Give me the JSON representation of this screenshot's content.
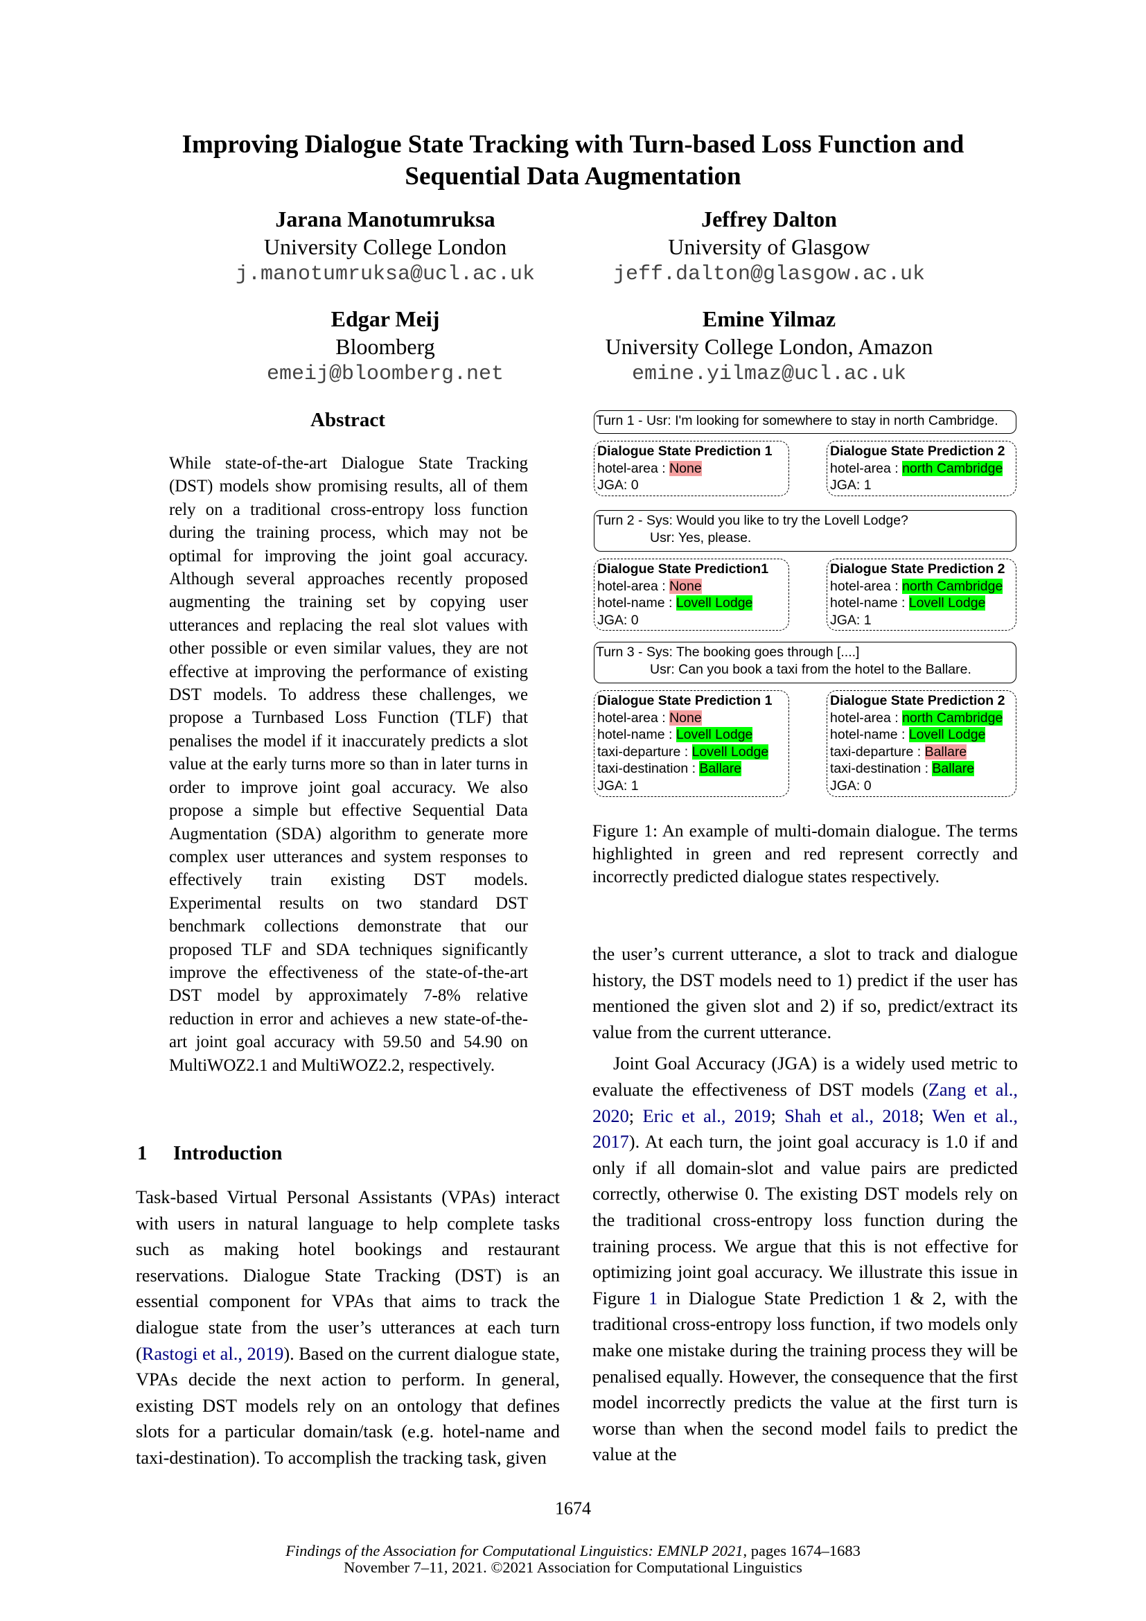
{
  "paper": {
    "title_line1": "Improving Dialogue State Tracking with Turn-based Loss Function and",
    "title_line2": "Sequential Data Augmentation",
    "authors": [
      {
        "name": "Jarana Manotumruksa",
        "affiliation": "University College London",
        "email": "j.manotumruksa@ucl.ac.uk"
      },
      {
        "name": "Jeffrey Dalton",
        "affiliation": "University of Glasgow",
        "email": "jeff.dalton@glasgow.ac.uk"
      },
      {
        "name": "Edgar Meij",
        "affiliation": "Bloomberg",
        "email": "emeij@bloomberg.net"
      },
      {
        "name": "Emine Yilmaz",
        "affiliation": "University College London, Amazon",
        "email": "emine.yilmaz@ucl.ac.uk"
      }
    ],
    "abstract_heading": "Abstract",
    "abstract_text": "While state-of-the-art Dialogue State Tracking (DST) models show promising results, all of them rely on a traditional cross-entropy loss function during the training process, which may not be optimal for improving the joint goal accuracy.  Although several approaches recently proposed augmenting the training set by copying user utterances and replacing the real slot values with other possible or even sim­ilar values, they are not effective at improving the performance of existing DST models.  To address these challenges, we propose a Turn­based Loss Function (TLF) that penalises the model if it inaccurately predicts a slot value at the early turns more so than in later turns in order to improve joint goal accuracy.  We also propose a simple but effective Sequential Data Augmentation (SDA) algorithm to gen­erate more complex user utterances and sys­tem responses to effectively train existing DST models.  Experimental results on two stan­dard DST benchmark collections demonstrate that our proposed TLF and SDA techniques significantly improve the effectiveness of the state-of-the-art DST model by approximately 7-8% relative reduction in error and achieves a new state-of-the-art joint goal accuracy with 59.50 and 54.90 on MultiWOZ2.1 and Multi­WOZ2.2, respectively.",
    "section1": {
      "number": "1",
      "title": "Introduction"
    },
    "intro_left": {
      "before_cite": "Task-based Virtual Personal Assistants (VPAs) in­teract with users in natural language to help com­plete tasks such as making hotel bookings and restaurant reservations. Dialogue State Tracking (DST) is an essential component for VPAs that aims to track the dialogue state from the user’s ut­terances at each turn (",
      "cite": "Rastogi et al., 2019",
      "after_cite": "). Based on the current dialogue state, VPAs decide the next action to perform. In general, existing DST models rely on an ontology that defines slots for a particular domain/task (e.g. hotel-name and taxi-destination). To accomplish the tracking task, given"
    },
    "intro_right_p1": "the user’s current utterance, a slot to track and dia­logue history, the DST models need to 1) predict if the user has mentioned the given slot and 2) if so, predict/extract its value from the current utterance.",
    "intro_right_p2": {
      "start": "Joint Goal Accuracy (JGA) is a widely used metric to evaluate the effectiveness of DST mod­els (",
      "cites": [
        "Zang et al., 2020",
        "Eric et al., 2019",
        "Shah et al., 2018",
        "Wen et al., 2017"
      ],
      "sep": "; ",
      "mid": ").  At each turn, the joint goal accuracy is 1.0 if and only if all domain-slot and value pairs are predicted correctly, otherwise 0. The existing DST models rely on the traditional cross-entropy loss function during the training pro­cess. We argue that this is not effective for optimiz­ing joint goal accuracy. We illustrate this issue in Figure ",
      "fig_ref": "1",
      "end": " in Dialogue State Prediction 1 & 2, with the traditional cross-entropy loss function, if two models only make one mistake during the training process they will be penalised equally. However, the consequence that the first model incorrectly pre­dicts the value at the first turn is worse than when the second model fails to predict the value at the"
    },
    "figure": {
      "turns": [
        {
          "lines": [
            "Turn 1 - Usr: I'm looking for somewhere to stay in north Cambridge."
          ]
        },
        {
          "lines": [
            "Turn 2 - Sys: Would you like to try the Lovell Lodge?",
            "Usr: Yes, please."
          ]
        },
        {
          "lines": [
            "Turn 3 - Sys: The booking goes through [....]",
            "Usr: Can you book a taxi from the hotel to the Ballare."
          ]
        }
      ],
      "predictions": [
        [
          {
            "title": "Dialogue State Prediction 1",
            "slots": [
              {
                "slot": "hotel-area",
                "value": "None",
                "status": "incorrect"
              }
            ],
            "jga": "JGA: 0"
          },
          {
            "title": "Dialogue State Prediction 2",
            "slots": [
              {
                "slot": "hotel-area",
                "value": "north Cambridge",
                "status": "correct"
              }
            ],
            "jga": "JGA: 1"
          }
        ],
        [
          {
            "title": "Dialogue State Prediction1",
            "slots": [
              {
                "slot": "hotel-area",
                "value": "None",
                "status": "incorrect"
              },
              {
                "slot": "hotel-name",
                "value": "Lovell Lodge",
                "status": "correct"
              }
            ],
            "jga": "JGA: 0"
          },
          {
            "title": "Dialogue State Prediction 2",
            "slots": [
              {
                "slot": "hotel-area",
                "value": "north Cambridge",
                "status": "correct"
              },
              {
                "slot": "hotel-name",
                "value": "Lovell Lodge",
                "status": "correct"
              }
            ],
            "jga": "JGA: 1"
          }
        ],
        [
          {
            "title": "Dialogue State Prediction 1",
            "slots": [
              {
                "slot": "hotel-area",
                "value": "None",
                "status": "incorrect"
              },
              {
                "slot": "hotel-name",
                "value": "Lovell Lodge",
                "status": "correct"
              },
              {
                "slot": "taxi-departure",
                "value": "Lovell Lodge",
                "status": "correct"
              },
              {
                "slot": "taxi-destination",
                "value": "Ballare",
                "status": "correct"
              }
            ],
            "jga": "JGA: 1"
          },
          {
            "title": "Dialogue State Prediction 2",
            "slots": [
              {
                "slot": "hotel-area",
                "value": "north Cambridge",
                "status": "correct"
              },
              {
                "slot": "hotel-name",
                "value": "Lovell Lodge",
                "status": "correct"
              },
              {
                "slot": "taxi-departure",
                "value": "Ballare",
                "status": "incorrect"
              },
              {
                "slot": "taxi-destination",
                "value": "Ballare",
                "status": "correct"
              }
            ],
            "jga": "JGA: 0"
          }
        ]
      ],
      "colors": {
        "correct": "#00ff00",
        "incorrect": "#f4a0a0"
      },
      "caption": "Figure 1:  An example of multi-domain dialogue.  The terms highlighted in green and red represent correctly and incorrectly predicted dialogue states respectively."
    },
    "page_number": "1674",
    "footer": {
      "venue_italic": "Findings of the Association for Computational Linguistics: EMNLP 2021",
      "pages": ", pages 1674–1683",
      "line2": "November 7–11, 2021. ©2021 Association for Computational Linguistics"
    }
  }
}
